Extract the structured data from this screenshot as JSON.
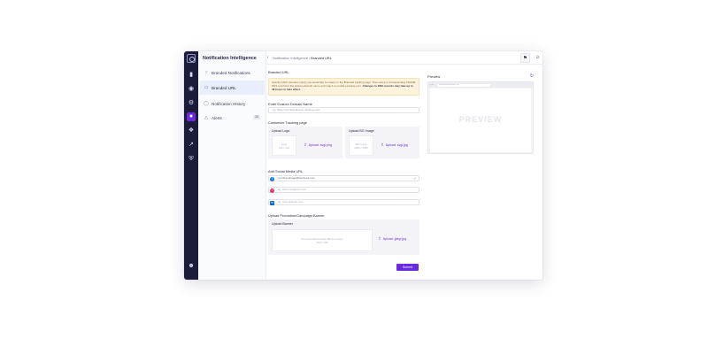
{
  "app": {
    "title": "Notification Intelligence"
  },
  "breadcrumb": {
    "parent": "Notification Intelligence",
    "separator": "/",
    "current": "Branded URL"
  },
  "rail": {
    "icons": [
      "logo-icon",
      "bar-chart-icon",
      "location-pin-icon",
      "gear-icon",
      "notification-icon",
      "puzzle-icon",
      "trend-icon",
      "shield-icon",
      "users-icon"
    ],
    "accent": "#6a2ae0",
    "background": "#1b1c3a"
  },
  "nav": {
    "items": [
      {
        "label": "Branded Notifications",
        "icon": "notification-icon"
      },
      {
        "label": "Branded URL",
        "icon": "monitor-icon",
        "active": true
      },
      {
        "label": "Notification History",
        "icon": "history-icon"
      },
      {
        "label": "Alerts",
        "icon": "alert-icon",
        "badge": "10"
      }
    ]
  },
  "form": {
    "section_title": "Branded URL",
    "warning": {
      "text": "Specify which domains (sites) you would like to create on the Branded tracking page. Then setup a corresponding CNAME DNS record for the custom domain name and map it to emails.example.com.",
      "strong": "Changes to DNS records may take up to 48 hours to take effect."
    },
    "domain": {
      "label": "Enter Custom Domain Name",
      "placeholder": "eg. https://yourbrandname.tracking.com/"
    },
    "tracking": {
      "label": "Customize Tracking page",
      "logo": {
        "title": "Upload Logo",
        "thumb_text": "Logo",
        "thumb_sub": "100 x 100",
        "link": "Upload .svg/.png"
      },
      "bg": {
        "title": "Upload BG Image",
        "thumb_text": "BG Image",
        "thumb_sub": "1920 x 1080",
        "link": "Upload .svg/.jpg"
      }
    },
    "social": {
      "label": "Add Social Media URL",
      "facebook": {
        "value": "yourbrandpage@facebook.com",
        "color": "#1877f2"
      },
      "instagram": {
        "placeholder": "eg. www.instagram.com",
        "color": "#e1306c"
      },
      "linkedin": {
        "placeholder": "eg. www.linkedin.com",
        "color": "#0a66c2"
      }
    },
    "banner": {
      "label": "Upload Promotion/Campaign Banner",
      "card_title": "Upload Banner",
      "thumb_text": "Promotional/Campaign Banner Image",
      "thumb_sub": "1000 x 200",
      "link": "Upload .jpeg/.jpg"
    },
    "submit_label": "Submit"
  },
  "preview": {
    "title": "Preview",
    "url": "www.yourbrandname.com",
    "placeholder": "PREVIEW"
  }
}
